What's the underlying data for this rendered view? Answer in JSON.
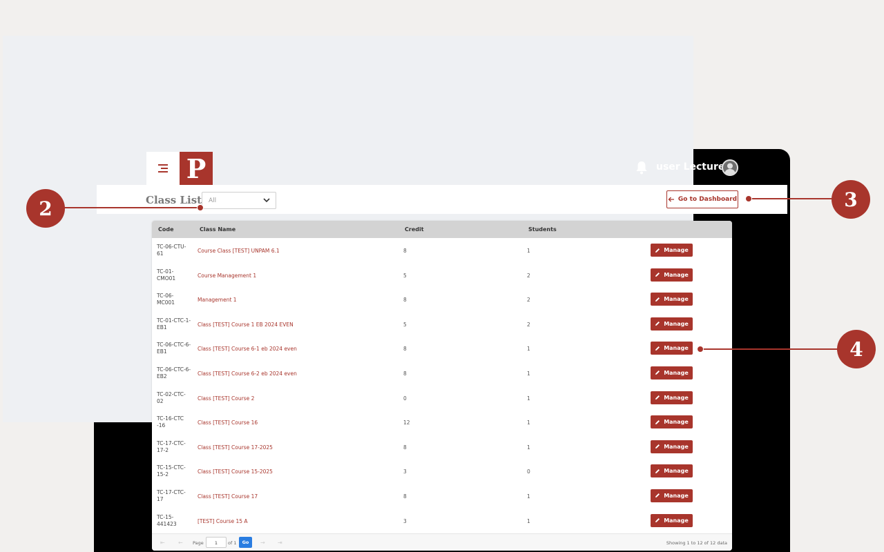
{
  "app": {
    "logo_letter": "P",
    "user_name": "user Lecture",
    "accent_color": "#a8352c"
  },
  "header": {
    "page_title": "Class List",
    "filter_value": "All",
    "dashboard_button": "Go to Dashboard"
  },
  "table": {
    "columns": [
      "Code",
      "Class Name",
      "Credit",
      "Students"
    ],
    "rows": [
      {
        "code": "TC-06-CTU-61",
        "name": "Course Class [TEST] UNPAM 6.1",
        "credit": "8",
        "students": "1"
      },
      {
        "code": "TC-01-CMO01",
        "name": "Course Management 1",
        "credit": "5",
        "students": "2"
      },
      {
        "code": "TC-06-MC001",
        "name": "Management 1",
        "credit": "8",
        "students": "2"
      },
      {
        "code": "TC-01-CTC-1-EB1",
        "name": "Class [TEST] Course 1 EB 2024 EVEN",
        "credit": "5",
        "students": "2"
      },
      {
        "code": "TC-06-CTC-6-EB1",
        "name": "Class [TEST] Course 6-1 eb 2024 even",
        "credit": "8",
        "students": "1"
      },
      {
        "code": "TC-06-CTC-6-EB2",
        "name": "Class [TEST] Course 6-2 eb 2024 even",
        "credit": "8",
        "students": "1"
      },
      {
        "code": "TC-02-CTC-02",
        "name": "Class [TEST] Course 2",
        "credit": "0",
        "students": "1"
      },
      {
        "code": "TC-16-CTC -16",
        "name": "Class [TEST] Course 16",
        "credit": "12",
        "students": "1"
      },
      {
        "code": "TC-17-CTC-17-2",
        "name": "Class [TEST] Course 17-2025",
        "credit": "8",
        "students": "1"
      },
      {
        "code": "TC-15-CTC-15-2",
        "name": "Class [TEST] Course 15-2025",
        "credit": "3",
        "students": "0"
      },
      {
        "code": "TC-17-CTC-17",
        "name": "Class [TEST] Course 17",
        "credit": "8",
        "students": "1"
      },
      {
        "code": "TC-15-441423",
        "name": "[TEST] Course 15 A",
        "credit": "3",
        "students": "1"
      }
    ],
    "manage_label": "Manage"
  },
  "pagination": {
    "page_label": "Page",
    "current_page": "1",
    "of_label": "of 1",
    "go_label": "Go",
    "info": "Showing 1 to 12 of 12 data"
  },
  "callouts": {
    "filter": "2",
    "dashboard": "3",
    "manage": "4"
  }
}
